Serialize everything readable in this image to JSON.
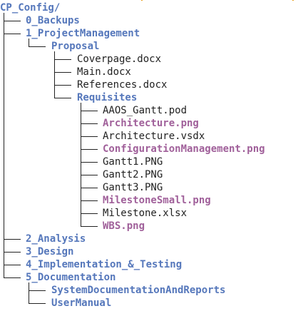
{
  "colors": {
    "directory": "#5577bb",
    "image_file": "#a0609a",
    "regular_file": "#222222",
    "tree_lines": "#222222"
  },
  "tree": {
    "root": "CP_Config/",
    "rows": [
      {
        "label": "0_Backups",
        "depth": 1,
        "kind": "dir",
        "last": false
      },
      {
        "label": "1_ProjectManagement",
        "depth": 1,
        "kind": "dir",
        "last": false
      },
      {
        "label": "Proposal",
        "depth": 2,
        "kind": "dir",
        "last": true
      },
      {
        "label": "Coverpage.docx",
        "depth": 3,
        "kind": "file",
        "last": false
      },
      {
        "label": "Main.docx",
        "depth": 3,
        "kind": "file",
        "last": false
      },
      {
        "label": "References.docx",
        "depth": 3,
        "kind": "file",
        "last": false
      },
      {
        "label": "Requisites",
        "depth": 3,
        "kind": "dir",
        "last": true
      },
      {
        "label": "AAOS_Gantt.pod",
        "depth": 4,
        "kind": "file",
        "last": false
      },
      {
        "label": "Architecture.png",
        "depth": 4,
        "kind": "image",
        "last": false
      },
      {
        "label": "Architecture.vsdx",
        "depth": 4,
        "kind": "file",
        "last": false
      },
      {
        "label": "ConfigurationManagement.png",
        "depth": 4,
        "kind": "image",
        "last": false
      },
      {
        "label": "Gantt1.PNG",
        "depth": 4,
        "kind": "file",
        "last": false
      },
      {
        "label": "Gantt2.PNG",
        "depth": 4,
        "kind": "file",
        "last": false
      },
      {
        "label": "Gantt3.PNG",
        "depth": 4,
        "kind": "file",
        "last": false
      },
      {
        "label": "MilestoneSmall.png",
        "depth": 4,
        "kind": "image",
        "last": false
      },
      {
        "label": "Milestone.xlsx",
        "depth": 4,
        "kind": "file",
        "last": false
      },
      {
        "label": "WBS.png",
        "depth": 4,
        "kind": "image",
        "last": true
      },
      {
        "label": "2_Analysis",
        "depth": 1,
        "kind": "dir",
        "last": false
      },
      {
        "label": "3_Design",
        "depth": 1,
        "kind": "dir",
        "last": false
      },
      {
        "label": "4_Implementation_&_Testing",
        "depth": 1,
        "kind": "dir",
        "last": false
      },
      {
        "label": "5_Documentation",
        "depth": 1,
        "kind": "dir",
        "last": true
      },
      {
        "label": "SystemDocumentationAndReports",
        "depth": 2,
        "kind": "dir",
        "last": false
      },
      {
        "label": "UserManual",
        "depth": 2,
        "kind": "dir",
        "last": true
      }
    ]
  }
}
